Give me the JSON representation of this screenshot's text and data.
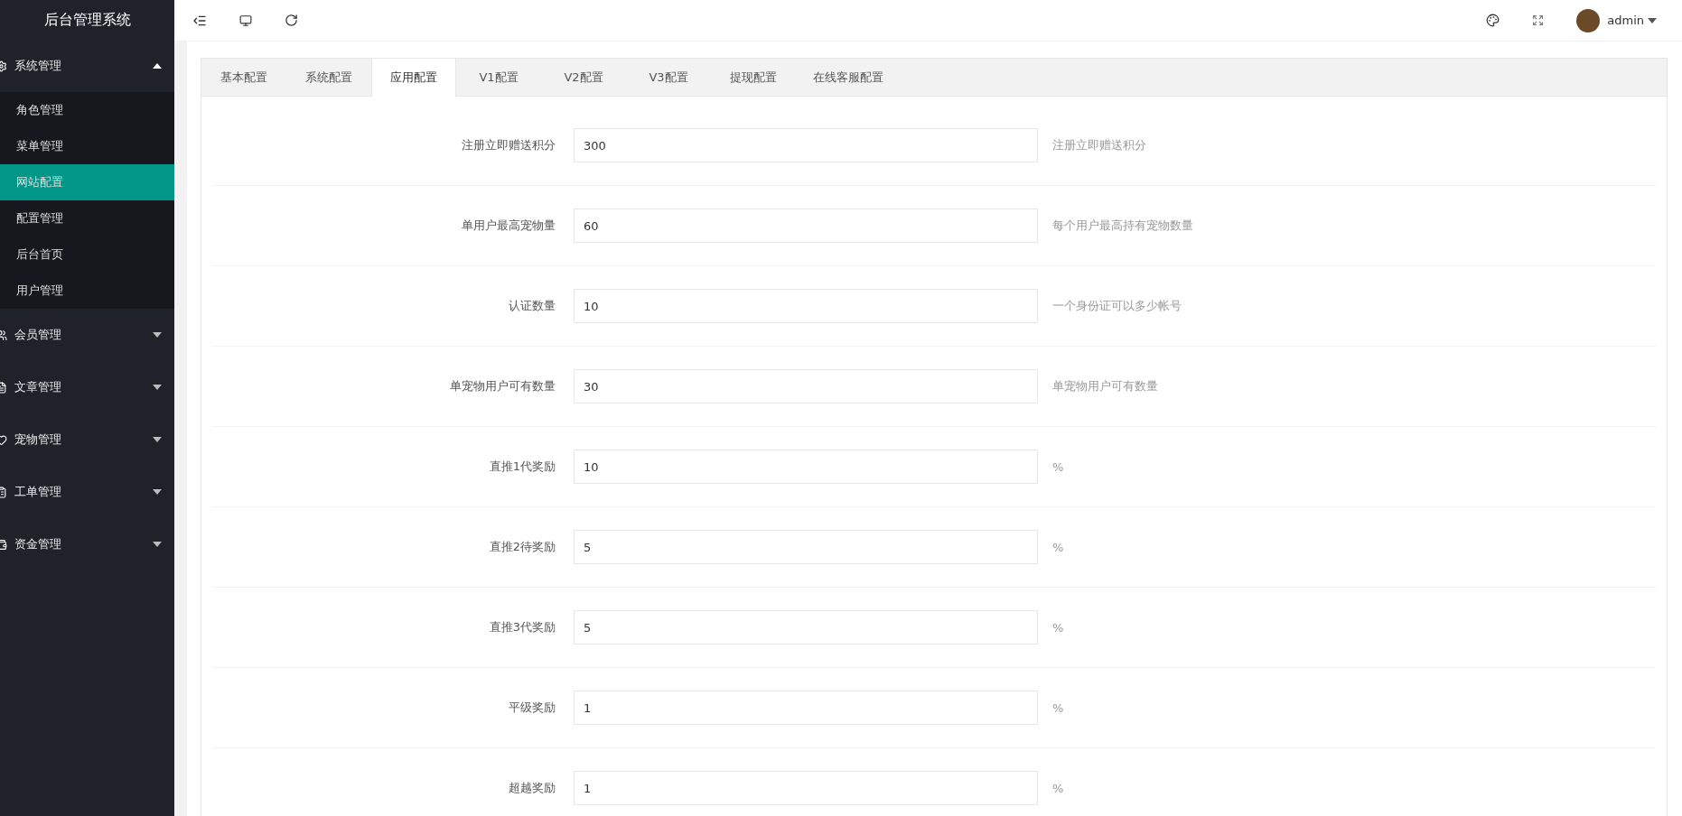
{
  "sidebar": {
    "title": "后台管理系统",
    "groups": [
      {
        "label": "系统管理",
        "expanded": true,
        "children": [
          {
            "label": "角色管理",
            "selected": false
          },
          {
            "label": "菜单管理",
            "selected": false
          },
          {
            "label": "网站配置",
            "selected": true
          },
          {
            "label": "配置管理",
            "selected": false
          },
          {
            "label": "后台首页",
            "selected": false
          },
          {
            "label": "用户管理",
            "selected": false
          }
        ]
      },
      {
        "label": "会员管理",
        "expanded": false
      },
      {
        "label": "文章管理",
        "expanded": false
      },
      {
        "label": "宠物管理",
        "expanded": false
      },
      {
        "label": "工单管理",
        "expanded": false
      },
      {
        "label": "资金管理",
        "expanded": false
      }
    ]
  },
  "header": {
    "user": "admin"
  },
  "tabs": [
    {
      "label": "基本配置",
      "selected": false
    },
    {
      "label": "系统配置",
      "selected": false
    },
    {
      "label": "应用配置",
      "selected": true
    },
    {
      "label": "V1配置",
      "selected": false
    },
    {
      "label": "V2配置",
      "selected": false
    },
    {
      "label": "V3配置",
      "selected": false
    },
    {
      "label": "提现配置",
      "selected": false
    },
    {
      "label": "在线客服配置",
      "selected": false
    }
  ],
  "form": [
    {
      "label": "注册立即赠送积分",
      "value": "300",
      "help": "注册立即赠送积分"
    },
    {
      "label": "单用户最高宠物量",
      "value": "60",
      "help": "每个用户最高持有宠物数量"
    },
    {
      "label": "认证数量",
      "value": "10",
      "help": "一个身份证可以多少帐号"
    },
    {
      "label": "单宠物用户可有数量",
      "value": "30",
      "help": "单宠物用户可有数量"
    },
    {
      "label": "直推1代奖励",
      "value": "10",
      "help": "%"
    },
    {
      "label": "直推2待奖励",
      "value": "5",
      "help": "%"
    },
    {
      "label": "直推3代奖励",
      "value": "5",
      "help": "%"
    },
    {
      "label": "平级奖励",
      "value": "1",
      "help": "%"
    },
    {
      "label": "超越奖励",
      "value": "1",
      "help": "%"
    }
  ]
}
